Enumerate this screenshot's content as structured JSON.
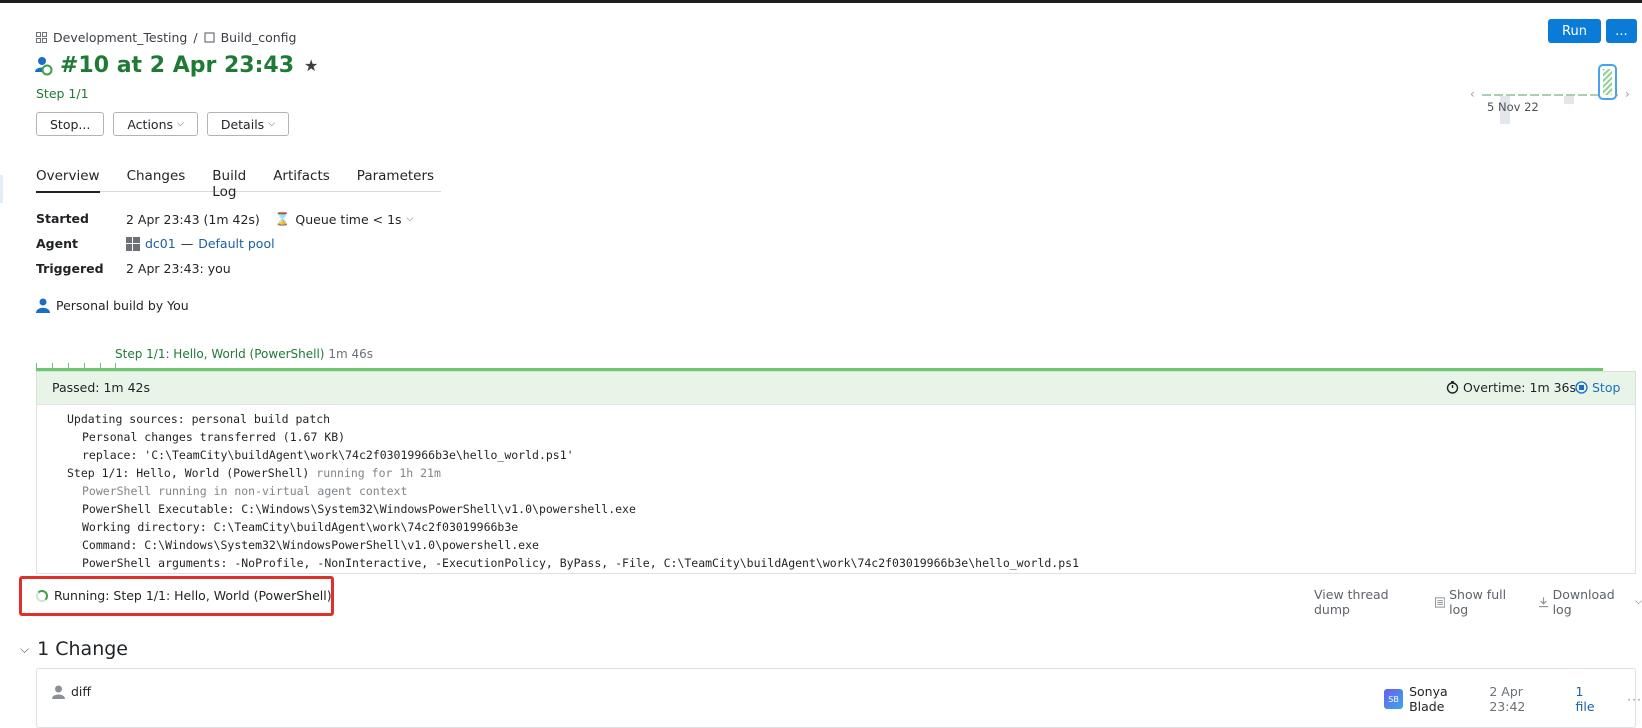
{
  "breadcrumb": {
    "project": "Development_Testing",
    "separator": "/",
    "config": "Build_config"
  },
  "build": {
    "title": "#10 at 2 Apr 23:43",
    "step": "Step 1/1",
    "status_color": "#1f7a36"
  },
  "toolbar": {
    "stop_label": "Stop...",
    "actions_label": "Actions",
    "details_label": "Details",
    "run_label": "Run",
    "more_label": "..."
  },
  "history": {
    "date_label": "5 Nov 22"
  },
  "tabs": [
    {
      "label": "Overview",
      "active": true
    },
    {
      "label": "Changes"
    },
    {
      "label": "Build Log"
    },
    {
      "label": "Artifacts"
    },
    {
      "label": "Parameters"
    }
  ],
  "info": {
    "started_label": "Started",
    "started_value": "2 Apr 23:43 (1m 42s)",
    "queue_time": "Queue time < 1s",
    "agent_label": "Agent",
    "agent_name": "dc01",
    "agent_dash": "—",
    "agent_pool": "Default pool",
    "triggered_label": "Triggered",
    "triggered_value": "2 Apr 23:43: you",
    "personal_build": "Personal build by You"
  },
  "step_progress": {
    "title": "Step 1/1: Hello, World (PowerShell)",
    "duration": "1m 46s",
    "passed": "Passed: 1m 42s",
    "overtime": "Overtime: 1m 36s",
    "stop": "Stop"
  },
  "log": {
    "lines": [
      {
        "text": "Updating sources: personal build patch",
        "indent": 1
      },
      {
        "text": "Personal changes transferred (1.67 KB)",
        "indent": 2
      },
      {
        "text": "replace: 'C:\\TeamCity\\buildAgent\\work\\74c2f03019966b3e\\hello_world.ps1'",
        "indent": 2
      },
      {
        "text": "Step 1/1: Hello, World (PowerShell)",
        "indent": 1,
        "suffix": "running for 1h 21m"
      },
      {
        "text": "PowerShell running in non-virtual agent context",
        "indent": 2,
        "gray": true
      },
      {
        "text": "PowerShell Executable: C:\\Windows\\System32\\WindowsPowerShell\\v1.0\\powershell.exe",
        "indent": 2
      },
      {
        "text": "Working directory: C:\\TeamCity\\buildAgent\\work\\74c2f03019966b3e",
        "indent": 2
      },
      {
        "text": "Command: C:\\Windows\\System32\\WindowsPowerShell\\v1.0\\powershell.exe",
        "indent": 2
      },
      {
        "text": "PowerShell arguments: -NoProfile, -NonInteractive, -ExecutionPolicy, ByPass, -File, C:\\TeamCity\\buildAgent\\work\\74c2f03019966b3e\\hello_world.ps1",
        "indent": 2
      }
    ]
  },
  "running": {
    "text": "Running: Step 1/1: Hello, World (PowerShell)"
  },
  "log_actions": {
    "thread_dump": "View thread dump",
    "full_log": "Show full log",
    "download": "Download log"
  },
  "changes": {
    "header": "1 Change",
    "item_title": "diff",
    "author_initials": "SB",
    "author": "Sonya Blade",
    "time": "2 Apr 23:42",
    "files": "1 file",
    "more": "···"
  }
}
